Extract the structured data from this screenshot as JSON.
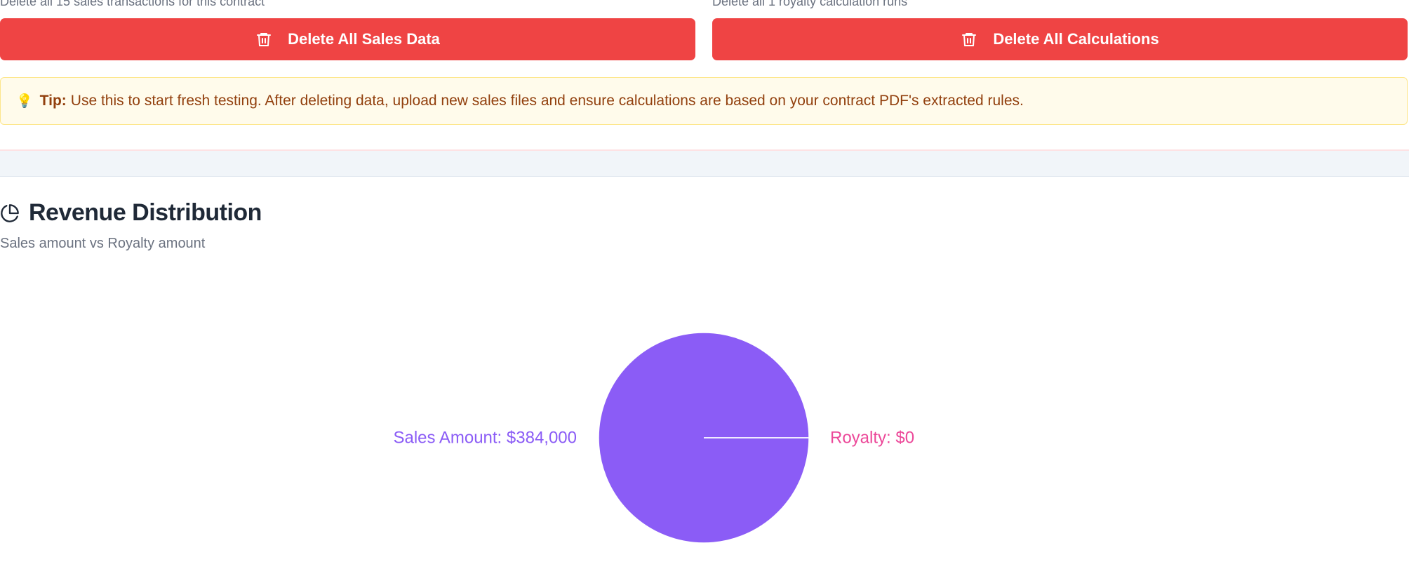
{
  "actions": {
    "sales": {
      "helper": "Delete all 15 sales transactions for this contract",
      "button_label": "Delete All Sales Data",
      "icon": "trash-icon"
    },
    "calculations": {
      "helper": "Delete all 1 royalty calculation runs",
      "button_label": "Delete All Calculations",
      "icon": "trash-icon"
    },
    "button_color": "#ef4444"
  },
  "tip": {
    "icon": "lightbulb-icon",
    "label": "Tip:",
    "text": "Use this to start fresh testing. After deleting data, upload new sales files and ensure calculations are based on your contract PDF's extracted rules."
  },
  "section": {
    "icon": "pie-chart-icon",
    "title": "Revenue Distribution",
    "subtitle": "Sales amount vs Royalty amount"
  },
  "chart_data": {
    "type": "pie",
    "title": "Revenue Distribution",
    "subtitle": "Sales amount vs Royalty amount",
    "slices": [
      {
        "name": "Sales Amount",
        "value": 384000,
        "label": "Sales Amount: $384,000",
        "color": "#8b5cf6"
      },
      {
        "name": "Royalty",
        "value": 0,
        "label": "Royalty: $0",
        "color": "#ec4899"
      }
    ],
    "legend": "none",
    "label_placement": "outside"
  }
}
